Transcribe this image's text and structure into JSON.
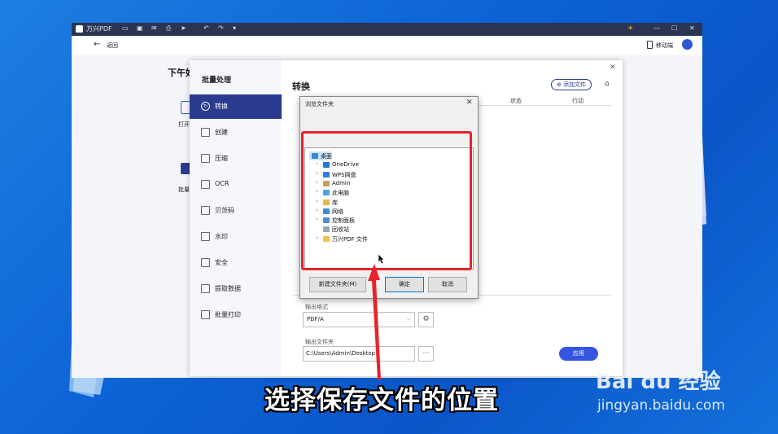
{
  "app": {
    "title": "万兴PDF",
    "back_label": "返回",
    "mobile_label": "移动端",
    "greeting": "下午好",
    "left_tiles": [
      "打开",
      "批量"
    ]
  },
  "panel": {
    "title": "批量处理",
    "sidebar": [
      {
        "label": "转换",
        "icon": "refresh-icon",
        "active": true
      },
      {
        "label": "创建",
        "icon": "create-icon",
        "active": false
      },
      {
        "label": "压缩",
        "icon": "compress-icon",
        "active": false
      },
      {
        "label": "OCR",
        "icon": "ocr-icon",
        "active": false
      },
      {
        "label": "贝茨码",
        "icon": "bates-icon",
        "active": false
      },
      {
        "label": "水印",
        "icon": "watermark-icon",
        "active": false
      },
      {
        "label": "安全",
        "icon": "lock-icon",
        "active": false
      },
      {
        "label": "提取数据",
        "icon": "chart-icon",
        "active": false
      },
      {
        "label": "批量打印",
        "icon": "print-icon",
        "active": false
      }
    ],
    "heading": "转换",
    "add_file": "添加文件",
    "columns": {
      "status": "状态",
      "action": "行动"
    },
    "output_format_label": "输出格式",
    "output_format_value": "PDF/A",
    "output_folder_label": "输出文件夹",
    "output_folder_value": "C:\\Users\\Admin\\Desktop",
    "more_label": "···",
    "apply": "应用"
  },
  "dialog": {
    "title": "浏览文件夹",
    "tree": [
      {
        "label": "桌面",
        "expand": false,
        "color": "#3a86d6",
        "selected": true
      },
      {
        "label": "OneDrive",
        "expand": true,
        "color": "#1f78d1"
      },
      {
        "label": "WPS网盘",
        "expand": true,
        "color": "#2f7fe0"
      },
      {
        "label": "Admin",
        "expand": true,
        "color": "#c9a063"
      },
      {
        "label": "此电脑",
        "expand": true,
        "color": "#4aa3e8"
      },
      {
        "label": "库",
        "expand": true,
        "color": "#e6b84a"
      },
      {
        "label": "网络",
        "expand": true,
        "color": "#3d8ad8"
      },
      {
        "label": "控制面板",
        "expand": true,
        "color": "#4f8fd0"
      },
      {
        "label": "回收站",
        "expand": false,
        "color": "#9aa6b4"
      },
      {
        "label": "万兴PDF 文件",
        "expand": true,
        "color": "#f0c24d"
      }
    ],
    "new_folder": "新建文件夹(M)",
    "ok": "确定",
    "cancel": "取消"
  },
  "caption": "选择保存文件的位置",
  "watermark": {
    "brand": "Bai du 经验",
    "url": "jingyan.baidu.com"
  },
  "colors": {
    "accent": "#2b3b8f",
    "highlight": "#e8232a",
    "caption_stroke": "#000000"
  }
}
